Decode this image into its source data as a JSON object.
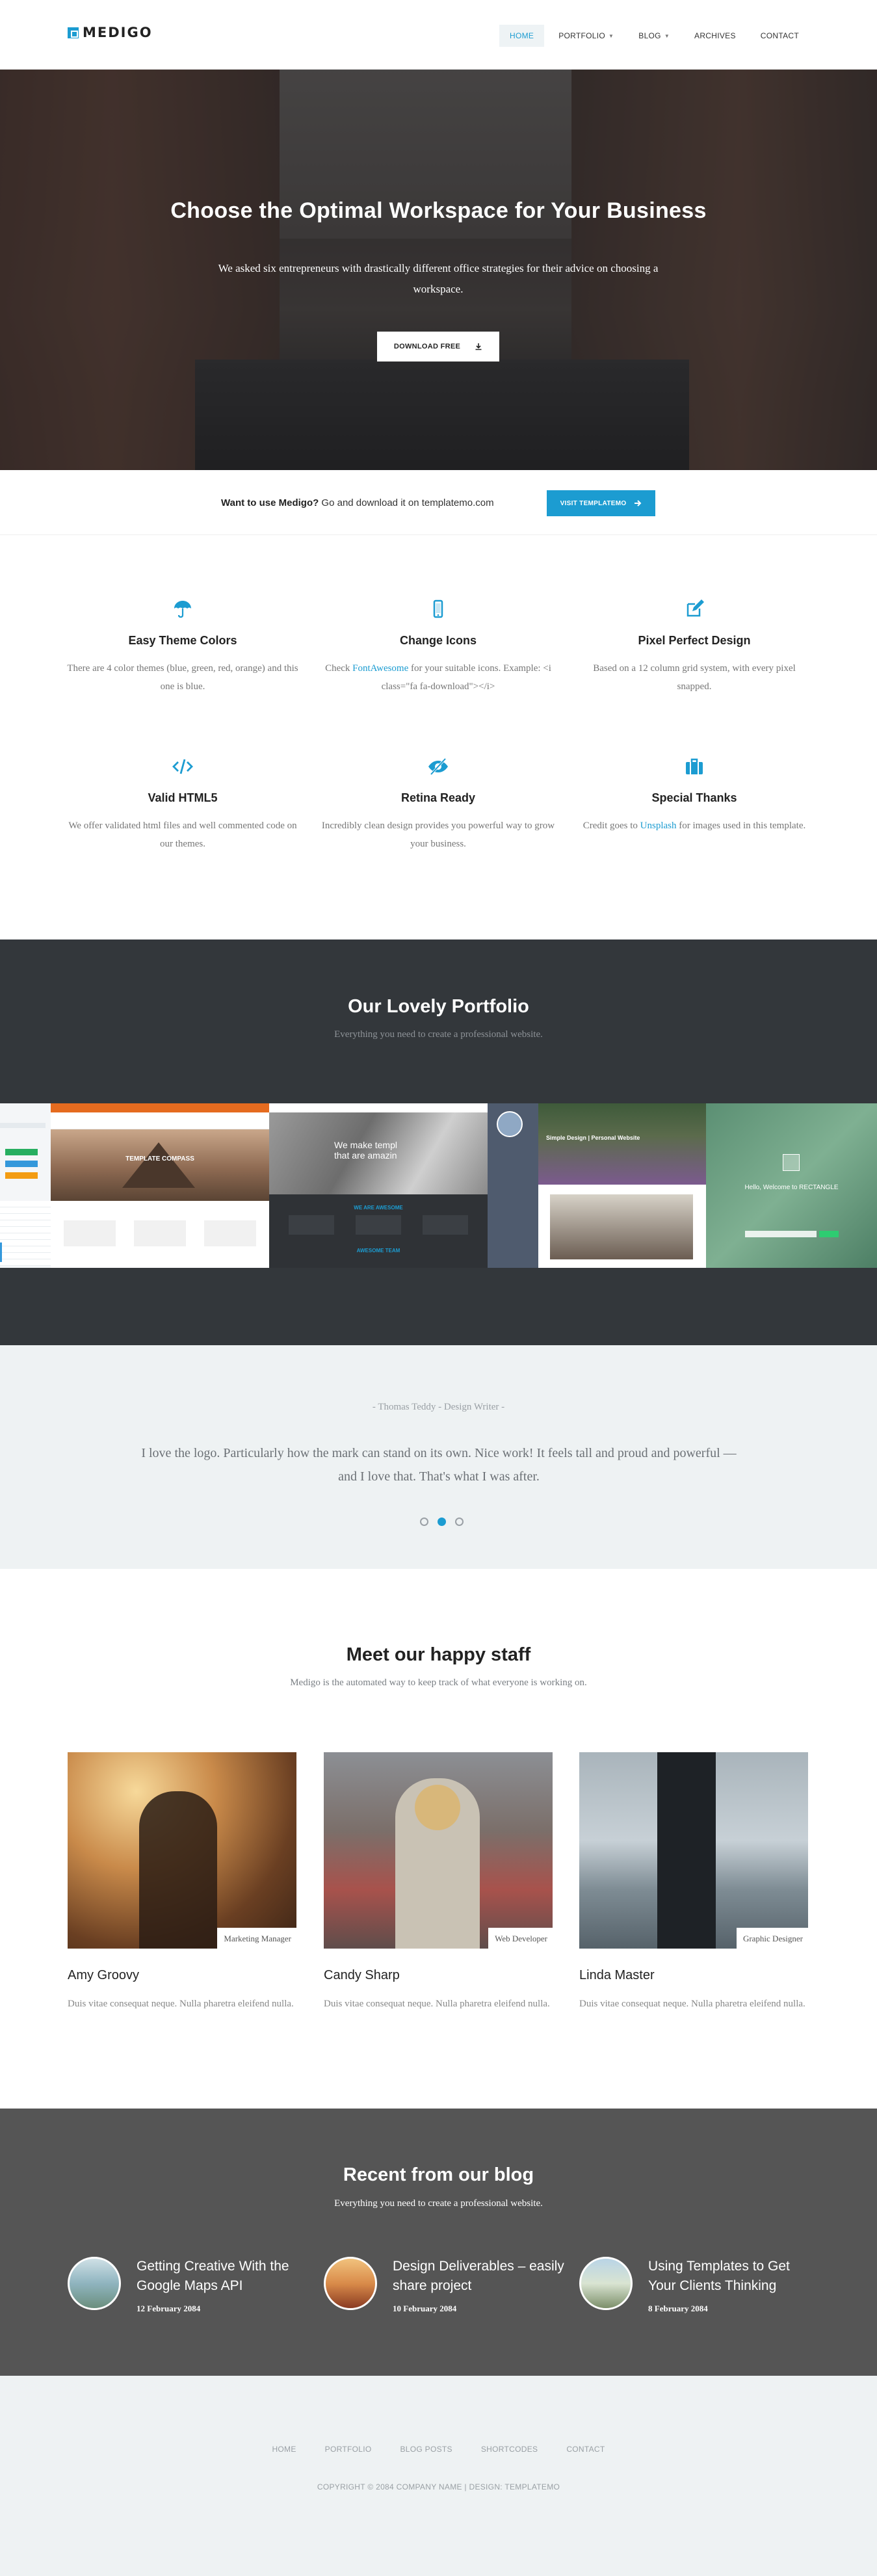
{
  "nav": {
    "logo_text": "MEDIGO",
    "items": [
      {
        "label": "HOME",
        "active": true,
        "dropdown": false
      },
      {
        "label": "PORTFOLIO",
        "active": false,
        "dropdown": true
      },
      {
        "label": "BLOG",
        "active": false,
        "dropdown": true
      },
      {
        "label": "ARCHIVES",
        "active": false,
        "dropdown": false
      },
      {
        "label": "CONTACT",
        "active": false,
        "dropdown": false
      }
    ]
  },
  "hero": {
    "title": "Choose the Optimal Workspace for Your Business",
    "subtitle": "We asked six entrepreneurs with drastically different office strategies for their advice on choosing a workspace.",
    "button_label": "DOWNLOAD FREE"
  },
  "cta": {
    "bold": "Want to use Medigo?",
    "text": " Go and download it on templatemo.com",
    "button_label": "VISIT TEMPLATEMO"
  },
  "features": [
    {
      "icon": "umbrella-icon",
      "title": "Easy Theme Colors",
      "text": "There are 4 color themes (blue, green, red, orange) and this one is blue."
    },
    {
      "icon": "mobile-icon",
      "title": "Change Icons",
      "text_pre": "Check ",
      "link": "FontAwesome",
      "text_post": " for your suitable icons. Example: <i class=\"fa fa-download\"></i>"
    },
    {
      "icon": "edit-icon",
      "title": "Pixel Perfect Design",
      "text": "Based on a 12 column grid system, with every pixel snapped."
    },
    {
      "icon": "code-icon",
      "title": "Valid HTML5",
      "text": "We offer validated html files and well commented code on our themes."
    },
    {
      "icon": "eye-slash-icon",
      "title": "Retina Ready",
      "text": "Incredibly clean design provides you powerful way to grow your business."
    },
    {
      "icon": "briefcase-icon",
      "title": "Special Thanks",
      "text_pre": "Credit goes to ",
      "link": "Unsplash",
      "text_post": " for images used in this template."
    }
  ],
  "portfolio": {
    "title": "Our Lovely Portfolio",
    "subtitle": "Everything you need to create a professional website.",
    "shot_texts": {
      "compass": "TEMPLATE COMPASS",
      "mono_line1": "We make templ",
      "mono_line2": "that are amazin",
      "mono_section": "WE ARE AWESOME",
      "mono_footer": "AWESOME TEAM",
      "nature_title": "Simple Design | Personal Website",
      "green_title": "Hello, Welcome to RECTANGLE"
    }
  },
  "testimonial": {
    "author": "- Thomas Teddy - Design Writer -",
    "quote": "I love the logo. Particularly how the mark can stand on its own. Nice work! It feels tall and proud and powerful — and I love that. That's what I was after.",
    "slides": 3,
    "active_slide": 2
  },
  "staff": {
    "title": "Meet our happy staff",
    "subtitle": "Medigo is the automated way to keep track of what everyone is working on.",
    "members": [
      {
        "name": "Amy Groovy",
        "role": "Marketing Manager",
        "desc": "Duis vitae consequat neque. Nulla pharetra eleifend nulla."
      },
      {
        "name": "Candy Sharp",
        "role": "Web Developer",
        "desc": "Duis vitae consequat neque. Nulla pharetra eleifend nulla."
      },
      {
        "name": "Linda Master",
        "role": "Graphic Designer",
        "desc": "Duis vitae consequat neque. Nulla pharetra eleifend nulla."
      }
    ]
  },
  "blog": {
    "title": "Recent from our blog",
    "subtitle": "Everything you need to create a professional website.",
    "posts": [
      {
        "title": "Getting Creative With the Google Maps API",
        "date": "12 February 2084"
      },
      {
        "title": "Design Deliverables – easily share project",
        "date": "10 February 2084"
      },
      {
        "title": "Using Templates to Get Your Clients Thinking",
        "date": "8 February 2084"
      }
    ]
  },
  "footer": {
    "links": [
      "HOME",
      "PORTFOLIO",
      "BLOG POSTS",
      "SHORTCODES",
      "CONTACT"
    ],
    "copyright": "COPYRIGHT © 2084 COMPANY NAME | DESIGN: TEMPLATEMO"
  },
  "colors": {
    "accent": "#1c9cd1",
    "dark_section": "#33373b",
    "blog_bg": "#555555",
    "light_bg": "#eef2f3"
  }
}
